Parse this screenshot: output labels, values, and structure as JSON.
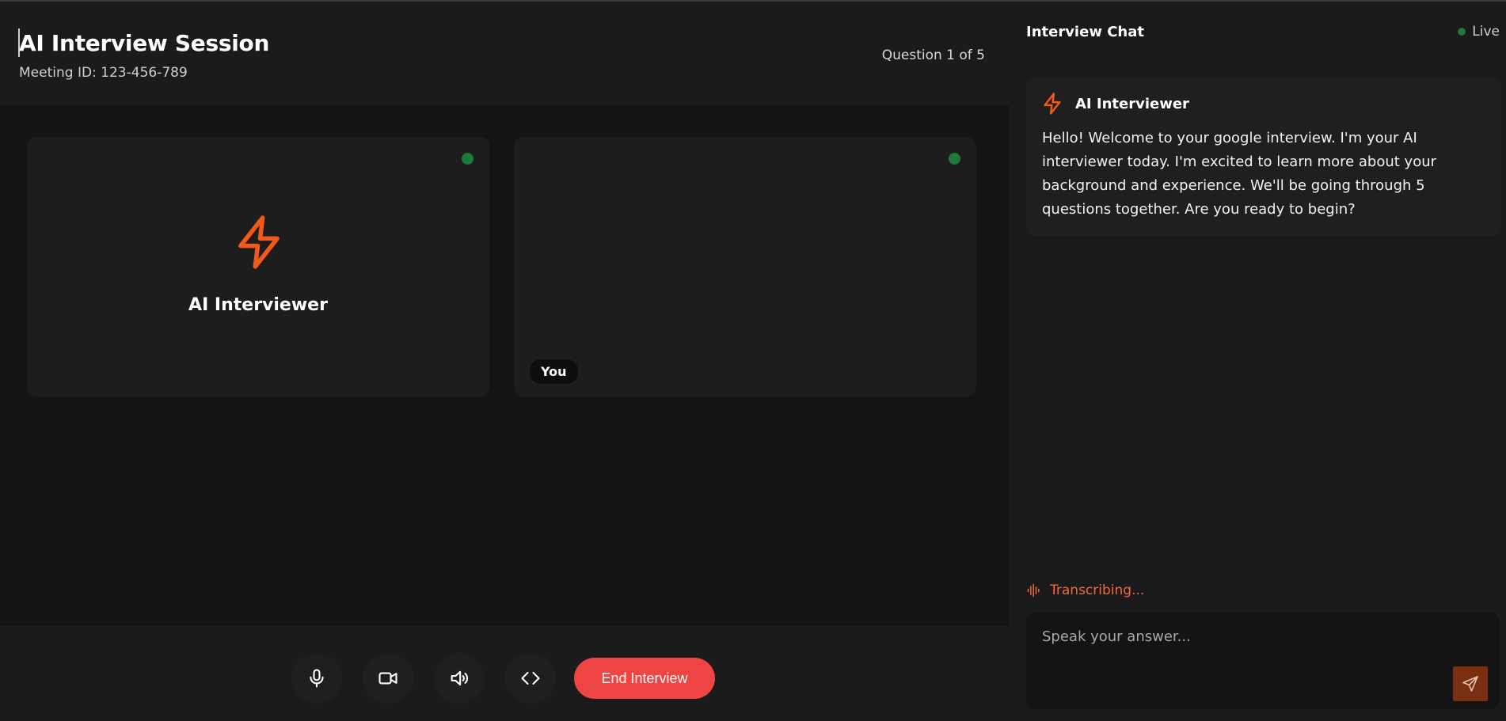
{
  "header": {
    "title": "AI Interview Session",
    "meeting_id": "Meeting ID: 123-456-789",
    "question_counter": "Question 1 of 5"
  },
  "tiles": {
    "ai_name": "AI Interviewer",
    "you_label": "You"
  },
  "controls": {
    "end_label": "End Interview",
    "icons": [
      "microphone-icon",
      "video-camera-icon",
      "speaker-icon",
      "code-icon"
    ]
  },
  "chat": {
    "title": "Interview Chat",
    "live_label": "Live",
    "messages": [
      {
        "author": "AI Interviewer",
        "text": "Hello! Welcome to your google interview. I'm your AI interviewer today. I'm excited to learn more about your background and experience. We'll be going through 5 questions together. Are you ready to begin?"
      }
    ],
    "transcribing_label": "Transcribing...",
    "input_placeholder": "Speak your answer..."
  },
  "colors": {
    "accent": "#f25a1c",
    "danger": "#ef4444",
    "online": "#1e7a36",
    "send_button": "#7a2e12"
  }
}
